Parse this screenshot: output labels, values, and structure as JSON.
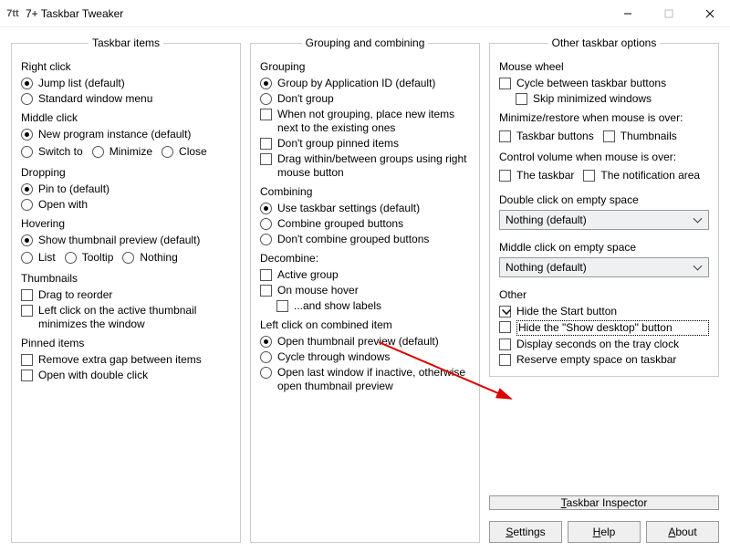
{
  "window": {
    "title": "7+ Taskbar Tweaker"
  },
  "panels": {
    "items": "Taskbar items",
    "group": "Grouping and combining",
    "other": "Other taskbar options"
  },
  "items": {
    "right_click": {
      "header": "Right click",
      "jump": "Jump list (default)",
      "std": "Standard window menu"
    },
    "middle_click": {
      "header": "Middle click",
      "newprog": "New program instance (default)",
      "switch": "Switch to",
      "minimize": "Minimize",
      "close": "Close"
    },
    "dropping": {
      "header": "Dropping",
      "pin": "Pin to (default)",
      "openwith": "Open with"
    },
    "hovering": {
      "header": "Hovering",
      "thumb": "Show thumbnail preview (default)",
      "list": "List",
      "tooltip": "Tooltip",
      "nothing": "Nothing"
    },
    "thumbnails": {
      "header": "Thumbnails",
      "drag": "Drag to reorder",
      "leftclick": "Left click on the active thumbnail minimizes the window"
    },
    "pinned": {
      "header": "Pinned items",
      "gap": "Remove extra gap between items",
      "dbl": "Open with double click"
    }
  },
  "group": {
    "grouping": {
      "header": "Grouping",
      "byapp": "Group by Application ID (default)",
      "dont": "Don't group",
      "place": "When not grouping, place new items next to the existing ones",
      "dontpin": "Don't group pinned items",
      "drag": "Drag within/between groups using right mouse button"
    },
    "combining": {
      "header": "Combining",
      "use": "Use taskbar settings (default)",
      "combine": "Combine grouped buttons",
      "dont": "Don't combine grouped buttons"
    },
    "decombine": {
      "header": "Decombine:",
      "active": "Active group",
      "hover": "On mouse hover",
      "labels": "...and show labels"
    },
    "leftclick": {
      "header": "Left click on combined item",
      "open": "Open thumbnail preview (default)",
      "cycle": "Cycle through windows",
      "last": "Open last window if inactive, otherwise open thumbnail preview"
    }
  },
  "other": {
    "wheel": {
      "header": "Mouse wheel",
      "cycle": "Cycle between taskbar buttons",
      "skip": "Skip minimized windows"
    },
    "minrest": {
      "header": "Minimize/restore when mouse is over:",
      "taskbar": "Taskbar buttons",
      "thumbs": "Thumbnails"
    },
    "volume": {
      "header": "Control volume when mouse is over:",
      "taskbar": "The taskbar",
      "notif": "The notification area"
    },
    "dblclick": {
      "header": "Double click on empty space",
      "value": "Nothing (default)"
    },
    "midclick": {
      "header": "Middle click on empty space",
      "value": "Nothing (default)"
    },
    "misc": {
      "header": "Other",
      "hide_start": "Hide the Start button",
      "hide_desktop": "Hide the \"Show desktop\" button",
      "seconds": "Display seconds on the tray clock",
      "reserve": "Reserve empty space on taskbar"
    },
    "buttons": {
      "inspector": "Taskbar Inspector",
      "settings": "Settings",
      "help": "Help",
      "about": "About"
    }
  }
}
